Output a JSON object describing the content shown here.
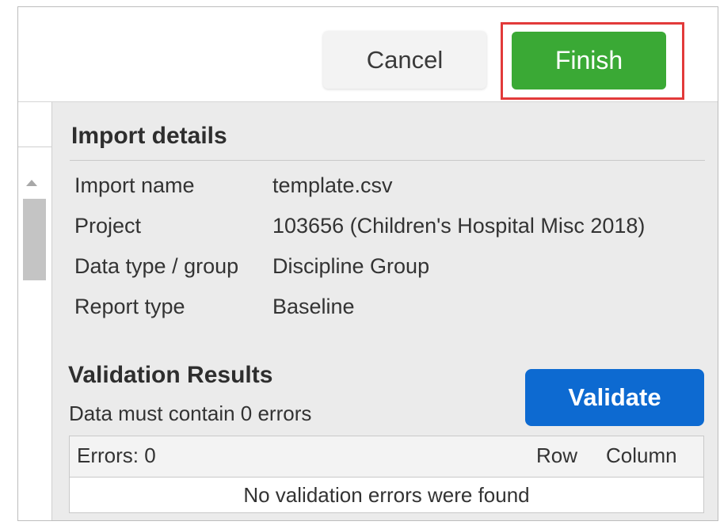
{
  "toolbar": {
    "cancel_label": "Cancel",
    "finish_label": "Finish"
  },
  "import_details": {
    "title": "Import details",
    "rows": [
      {
        "label": "Import name",
        "value": "template.csv"
      },
      {
        "label": "Project",
        "value": "103656 (Children's Hospital Misc 2018)"
      },
      {
        "label": "Data type / group",
        "value": "Discipline Group"
      },
      {
        "label": "Report type",
        "value": "Baseline"
      }
    ]
  },
  "validation": {
    "title": "Validation Results",
    "subtitle": "Data must contain 0 errors",
    "validate_label": "Validate",
    "table": {
      "errors_header": "Errors: 0",
      "row_header": "Row",
      "column_header": "Column",
      "empty_message": "No validation errors were found"
    }
  },
  "colors": {
    "finish": "#3aa935",
    "validate": "#0d6ad1",
    "highlight": "#e23a3a",
    "panel": "#ebebeb"
  }
}
